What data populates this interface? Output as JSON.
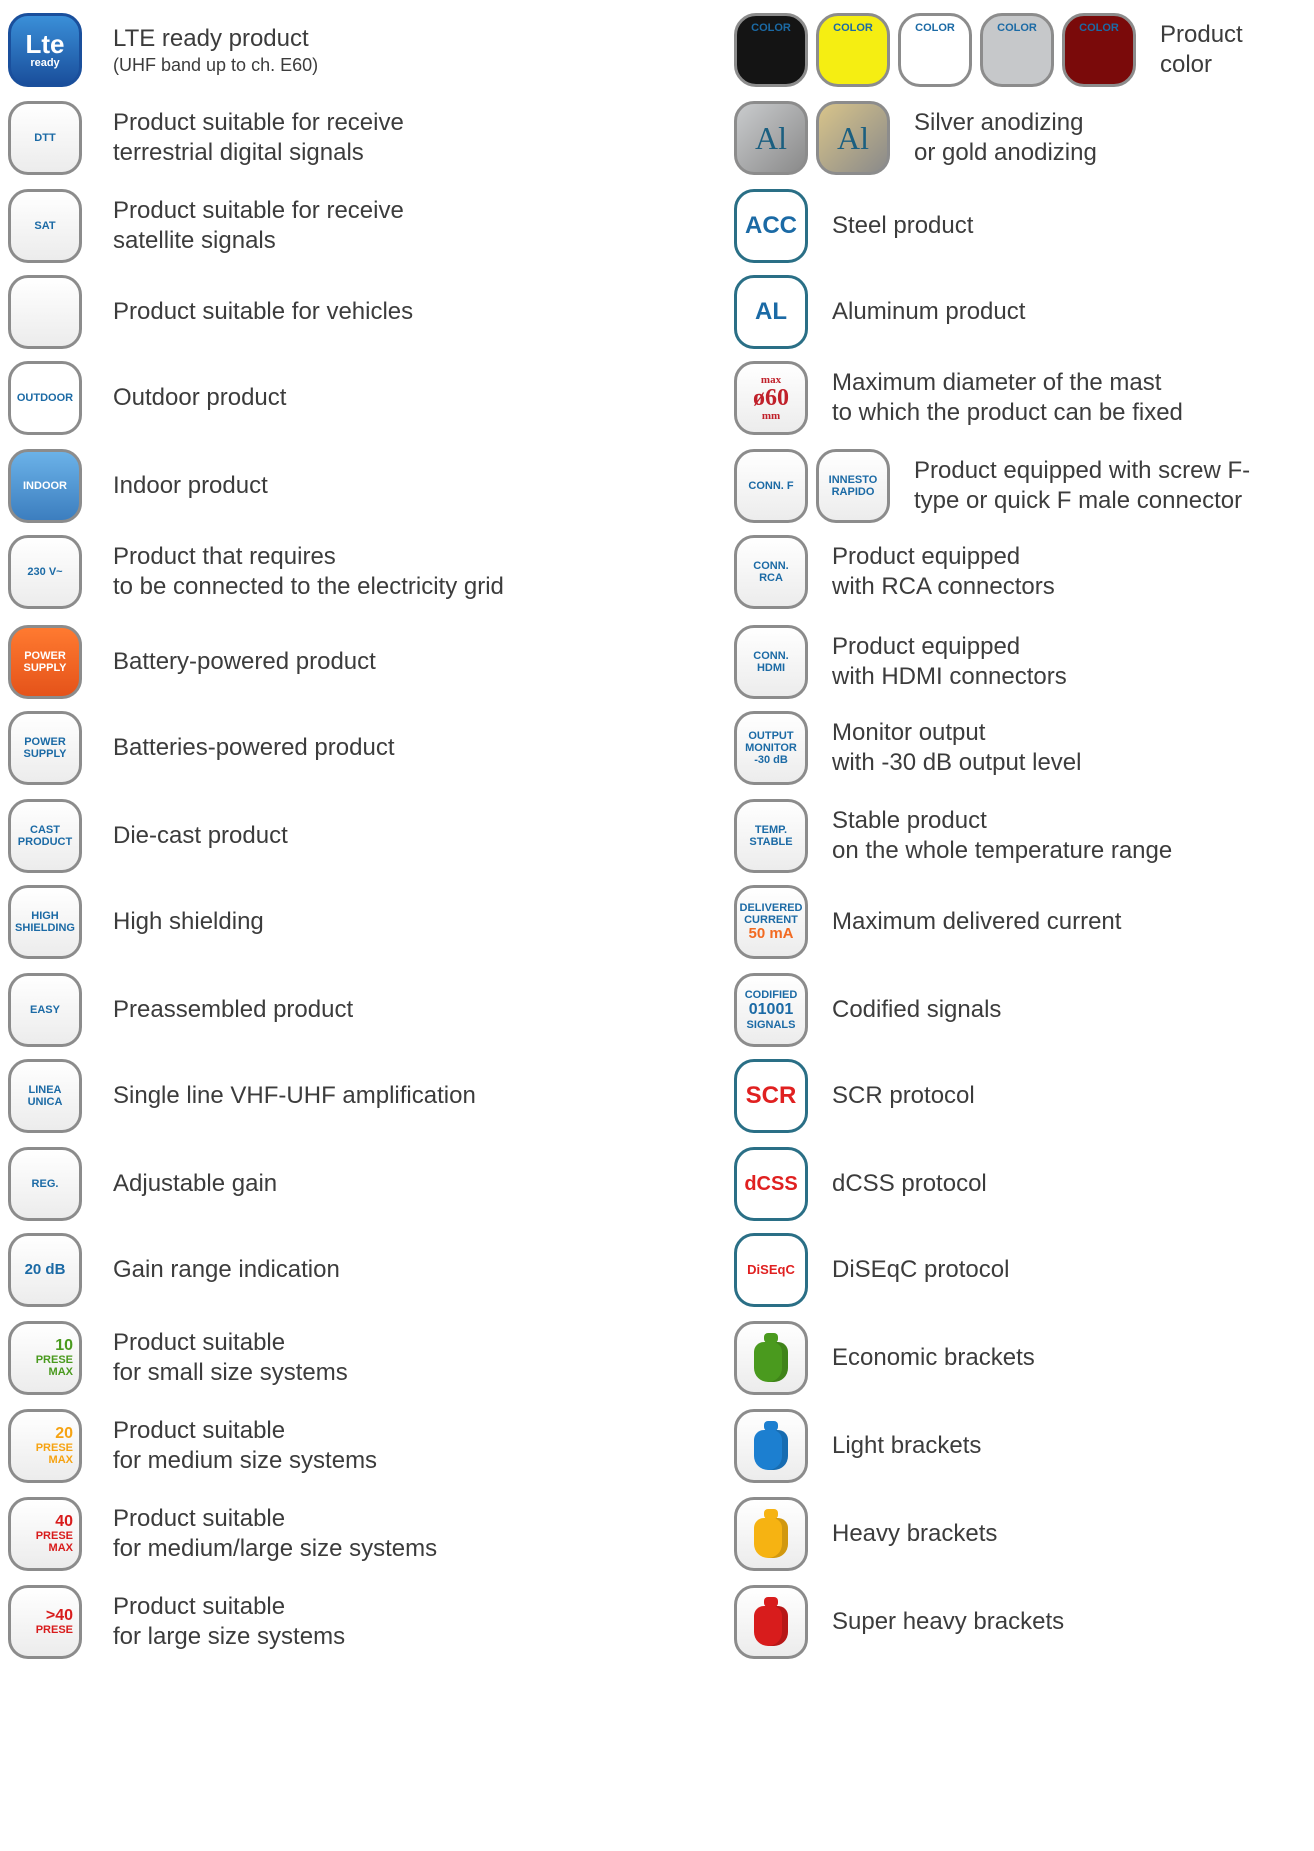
{
  "colors": {
    "accent": "#1b6aa5",
    "text": "#3c3c3c",
    "border": "#8c8c8c",
    "red": "#e02020",
    "orange": "#f26a21"
  },
  "left": [
    {
      "id": "lte",
      "icon": "lte-ready-icon",
      "icon_text": [
        "Lte",
        "ready"
      ],
      "lines": [
        "LTE ready product"
      ],
      "sub": "(UHF band up to ch. E60)"
    },
    {
      "id": "dtt",
      "icon": "dtt-antenna-icon",
      "icon_text": [
        "DTT"
      ],
      "lines": [
        "Product suitable for receive",
        "terrestrial digital signals"
      ]
    },
    {
      "id": "sat",
      "icon": "satellite-dish-icon",
      "icon_text": [
        "SAT"
      ],
      "lines": [
        "Product suitable for receive",
        "satellite signals"
      ]
    },
    {
      "id": "vehicle",
      "icon": "camper-vehicle-icon",
      "icon_text": [],
      "lines": [
        "Product suitable for vehicles"
      ]
    },
    {
      "id": "outdoor",
      "icon": "outdoor-rain-icon",
      "icon_text": [
        "OUTDOOR"
      ],
      "lines": [
        "Outdoor product"
      ]
    },
    {
      "id": "indoor",
      "icon": "indoor-house-icon",
      "icon_text": [
        "INDOOR"
      ],
      "lines": [
        "Indoor product"
      ]
    },
    {
      "id": "grid",
      "icon": "power-plug-icon",
      "icon_text": [
        "230 V~"
      ],
      "lines": [
        "Product that requires",
        "to be connected to the electricity grid"
      ]
    },
    {
      "id": "battery",
      "icon": "battery-supply-icon",
      "icon_text": [
        "POWER",
        "SUPPLY"
      ],
      "lines": [
        "Battery-powered product"
      ]
    },
    {
      "id": "batteries",
      "icon": "batteries-supply-icon",
      "icon_text": [
        "POWER",
        "SUPPLY"
      ],
      "lines": [
        "Batteries-powered product"
      ]
    },
    {
      "id": "diecast",
      "icon": "die-cast-icon",
      "icon_text": [
        "CAST",
        "PRODUCT"
      ],
      "lines": [
        "Die-cast product"
      ]
    },
    {
      "id": "shield",
      "icon": "high-shielding-icon",
      "icon_text": [
        "HIGH",
        "SHIELDING"
      ],
      "lines": [
        "High shielding"
      ]
    },
    {
      "id": "easy",
      "icon": "easy-tools-icon",
      "icon_text": [
        "EASY"
      ],
      "lines": [
        "Preassembled product"
      ]
    },
    {
      "id": "linea",
      "icon": "single-line-icon",
      "icon_text": [
        "LINEA",
        "UNICA"
      ],
      "lines": [
        "Single line VHF-UHF amplification"
      ]
    },
    {
      "id": "reg",
      "icon": "adjustable-gain-icon",
      "icon_text": [
        "REG."
      ],
      "lines": [
        "Adjustable gain"
      ]
    },
    {
      "id": "gain",
      "icon": "gain-range-icon",
      "icon_text": [
        "20 dB"
      ],
      "lines": [
        "Gain range indication"
      ]
    },
    {
      "id": "p10",
      "icon": "prese-10-icon",
      "icon_text": [
        "10",
        "PRESE",
        "MAX"
      ],
      "lines": [
        "Product suitable",
        "for small size systems"
      ]
    },
    {
      "id": "p20",
      "icon": "prese-20-icon",
      "icon_text": [
        "20",
        "PRESE",
        "MAX"
      ],
      "lines": [
        "Product suitable",
        "for medium size systems"
      ]
    },
    {
      "id": "p40",
      "icon": "prese-40-icon",
      "icon_text": [
        "40",
        "PRESE",
        "MAX"
      ],
      "lines": [
        "Product suitable",
        "for medium/large size systems"
      ]
    },
    {
      "id": "p40plus",
      "icon": "prese-over-40-icon",
      "icon_text": [
        ">40",
        "PRESE"
      ],
      "lines": [
        "Product suitable",
        "for large size systems"
      ]
    }
  ],
  "right_color": {
    "swatches": [
      {
        "label": "COLOR",
        "bg": "#141414",
        "fg": "#1b6aa5"
      },
      {
        "label": "COLOR",
        "bg": "#f5ee12",
        "fg": "#1b6aa5"
      },
      {
        "label": "COLOR",
        "bg": "#ffffff",
        "fg": "#1b6aa5"
      },
      {
        "label": "COLOR",
        "bg": "#c6c8ca",
        "fg": "#1b6aa5"
      },
      {
        "label": "COLOR",
        "bg": "#7a0a0a",
        "fg": "#1b6aa5"
      }
    ],
    "lines": [
      "Product",
      "color"
    ]
  },
  "right": [
    {
      "id": "anod",
      "icon": "anodizing-icon",
      "icon_text": [
        "Al",
        "Al"
      ],
      "lines": [
        "Silver anodizing",
        "or gold anodizing"
      ]
    },
    {
      "id": "acc",
      "icon": "steel-icon",
      "icon_text": [
        "ACC"
      ],
      "lines": [
        "Steel product"
      ]
    },
    {
      "id": "al",
      "icon": "aluminum-icon",
      "icon_text": [
        "AL"
      ],
      "lines": [
        "Aluminum product"
      ]
    },
    {
      "id": "mast",
      "icon": "mast-diameter-icon",
      "icon_text": [
        "max",
        "ø60",
        "mm"
      ],
      "lines": [
        "Maximum diameter of the mast",
        "to which the product can be fixed"
      ]
    },
    {
      "id": "conn",
      "icon": "f-connector-icon",
      "icon_text": [
        "CONN. F",
        "INNESTO",
        "RAPIDO"
      ],
      "lines": [
        "Product equipped with screw F-",
        "type or quick F male connector"
      ]
    },
    {
      "id": "rca",
      "icon": "rca-connector-icon",
      "icon_text": [
        "CONN.",
        "RCA"
      ],
      "lines": [
        "Product equipped",
        "with RCA connectors"
      ]
    },
    {
      "id": "hdmi",
      "icon": "hdmi-connector-icon",
      "icon_text": [
        "CONN.",
        "HDMI"
      ],
      "lines": [
        "Product equipped",
        "with HDMI connectors"
      ]
    },
    {
      "id": "monitor",
      "icon": "monitor-output-icon",
      "icon_text": [
        "OUTPUT",
        "MONITOR",
        "-30 dB"
      ],
      "lines": [
        "Monitor output",
        "with -30 dB output level"
      ]
    },
    {
      "id": "temp",
      "icon": "thermometer-icon",
      "icon_text": [
        "TEMP.",
        "STABLE"
      ],
      "lines": [
        "Stable product",
        "on the whole temperature range"
      ]
    },
    {
      "id": "current",
      "icon": "delivered-current-icon",
      "icon_text": [
        "DELIVERED",
        "CURRENT",
        "50 mA"
      ],
      "lines": [
        "Maximum delivered current"
      ]
    },
    {
      "id": "codified",
      "icon": "codified-signals-icon",
      "icon_text": [
        "CODIFIED",
        "01001",
        "SIGNALS"
      ],
      "lines": [
        "Codified signals"
      ]
    },
    {
      "id": "scr",
      "icon": "scr-icon",
      "icon_text": [
        "SCR"
      ],
      "lines": [
        "SCR protocol"
      ]
    },
    {
      "id": "dcss",
      "icon": "dcss-icon",
      "icon_text": [
        "dCSS"
      ],
      "lines": [
        "dCSS protocol"
      ]
    },
    {
      "id": "diseqc",
      "icon": "diseqc-icon",
      "icon_text": [
        "DiSEqC"
      ],
      "lines": [
        "DiSEqC protocol"
      ]
    },
    {
      "id": "eco",
      "icon": "weight-green-icon",
      "icon_text": [],
      "lines": [
        "Economic brackets"
      ],
      "color": "#4a9a1e"
    },
    {
      "id": "light",
      "icon": "weight-blue-icon",
      "icon_text": [],
      "lines": [
        "Light brackets"
      ],
      "color": "#1c7fd0"
    },
    {
      "id": "heavy",
      "icon": "weight-yellow-icon",
      "icon_text": [],
      "lines": [
        "Heavy brackets"
      ],
      "color": "#f6b312"
    },
    {
      "id": "super",
      "icon": "weight-red-icon",
      "icon_text": [],
      "lines": [
        "Super heavy brackets"
      ],
      "color": "#d81c1c"
    }
  ]
}
